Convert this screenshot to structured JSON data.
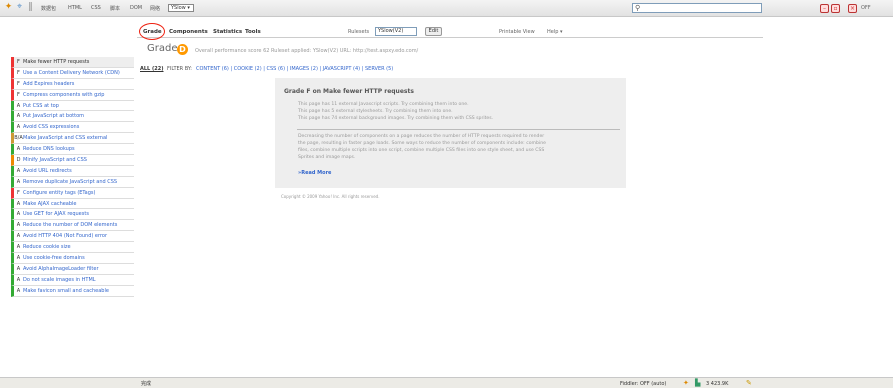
{
  "topbar": {
    "labels": [
      "数据包",
      "HTML",
      "CSS",
      "脚本",
      "DOM",
      "网络"
    ],
    "select": "YSlow ▾",
    "off": "OFF"
  },
  "tabs": {
    "grade": "Grade",
    "components": "Components",
    "statistics": "Statistics",
    "tools": "Tools"
  },
  "toolbar": {
    "rulesets_label": "Rulesets",
    "ruleset_value": "YSlow(V2)",
    "edit": "Edit",
    "printable": "Printable View",
    "help": "Help ▾"
  },
  "summary": {
    "grade_word": "Grade",
    "grade_letter": "D",
    "overall": "Overall performance score 62   Ruleset applied: YSlow(V2)   URL: http://test.aspxy.edo.com/"
  },
  "filter": {
    "all": "ALL (22)",
    "by": "FILTER BY:",
    "links": "CONTENT (6) | COOKIE (2) | CSS (6) | IMAGES (2) | JAVASCRIPT (4) | SERVER (5)"
  },
  "rules": [
    {
      "grade": "F",
      "name": "Make fewer HTTP requests",
      "cls": "gF sel"
    },
    {
      "grade": "F",
      "name": "Use a Content Delivery Network (CDN)",
      "cls": "gF"
    },
    {
      "grade": "F",
      "name": "Add Expires headers",
      "cls": "gF"
    },
    {
      "grade": "F",
      "name": "Compress components with gzip",
      "cls": "gF"
    },
    {
      "grade": "A",
      "name": "Put CSS at top",
      "cls": "gA"
    },
    {
      "grade": "A",
      "name": "Put JavaScript at bottom",
      "cls": "gA"
    },
    {
      "grade": "A",
      "name": "Avoid CSS expressions",
      "cls": "gA"
    },
    {
      "grade": "B/A",
      "name": "Make JavaScript and CSS external",
      "cls": "gB"
    },
    {
      "grade": "A",
      "name": "Reduce DNS lookups",
      "cls": "gA"
    },
    {
      "grade": "D",
      "name": "Minify JavaScript and CSS",
      "cls": "gD"
    },
    {
      "grade": "A",
      "name": "Avoid URL redirects",
      "cls": "gA"
    },
    {
      "grade": "A",
      "name": "Remove duplicate JavaScript and CSS",
      "cls": "gA"
    },
    {
      "grade": "F",
      "name": "Configure entity tags (ETags)",
      "cls": "gF"
    },
    {
      "grade": "A",
      "name": "Make AJAX cacheable",
      "cls": "gA"
    },
    {
      "grade": "A",
      "name": "Use GET for AJAX requests",
      "cls": "gA"
    },
    {
      "grade": "A",
      "name": "Reduce the number of DOM elements",
      "cls": "gA"
    },
    {
      "grade": "A",
      "name": "Avoid HTTP 404 (Not Found) error",
      "cls": "gA"
    },
    {
      "grade": "A",
      "name": "Reduce cookie size",
      "cls": "gA"
    },
    {
      "grade": "A",
      "name": "Use cookie-free domains",
      "cls": "gA"
    },
    {
      "grade": "A",
      "name": "Avoid AlphaImageLoader filter",
      "cls": "gA"
    },
    {
      "grade": "A",
      "name": "Do not scale images in HTML",
      "cls": "gA"
    },
    {
      "grade": "A",
      "name": "Make favicon small and cacheable",
      "cls": "gA"
    }
  ],
  "detail": {
    "title": "Grade F on Make fewer HTTP requests",
    "lines": [
      "This page has 11 external Javascript scripts. Try combining them into one.",
      "This page has 5 external stylesheets. Try combining them into one.",
      "This page has 74 external background images. Try combining them with CSS sprites."
    ],
    "desc": [
      "Decreasing the number of components on a page reduces the number of HTTP requests required to render",
      "the page, resulting in faster page loads. Some ways to reduce the number of components include: combine",
      "files, combine multiple scripts into one script, combine multiple CSS files into one style sheet, and use CSS",
      "Sprites and image maps."
    ],
    "read_more": "»Read More"
  },
  "copyright": "Copyright © 2009 Yahoo! Inc. All rights reserved.",
  "status": {
    "left": "完成",
    "fiddler": "Fiddler: OFF (auto)",
    "size": "3  423.9K"
  }
}
